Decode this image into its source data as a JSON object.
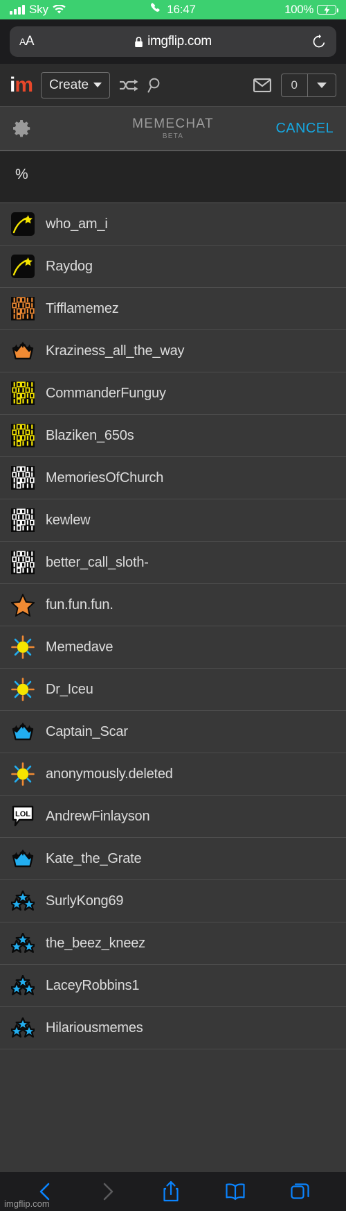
{
  "status_bar": {
    "carrier": "Sky",
    "signal_icon": "signal-bars-icon",
    "wifi_icon": "wifi-icon",
    "call_icon": "phone-call-icon",
    "time": "16:47",
    "battery_percent": "100%",
    "battery_icon": "battery-charging-icon"
  },
  "browser": {
    "text_size_small": "A",
    "text_size_big": "A",
    "lock_icon": "lock-icon",
    "url": "imgflip.com",
    "reload_icon": "reload-icon",
    "toolbar": {
      "back_icon": "chevron-left-icon",
      "forward_icon": "chevron-right-icon",
      "share_icon": "share-icon",
      "bookmarks_icon": "book-icon",
      "tabs_icon": "tabs-icon"
    }
  },
  "site_header": {
    "logo_i": "i",
    "logo_m": "m",
    "create_label": "Create",
    "create_caret_icon": "caret-down-icon",
    "shuffle_icon": "shuffle-icon",
    "search_icon": "search-icon",
    "mail_icon": "envelope-icon",
    "notification_count": "0",
    "notification_caret_icon": "caret-down-icon"
  },
  "memechat": {
    "gear_icon": "gear-icon",
    "title": "MEMECHAT",
    "subtitle": "BETA",
    "cancel_label": "CANCEL"
  },
  "search": {
    "value": "%",
    "placeholder": ""
  },
  "colors": {
    "status_bar_green": "#3cd070",
    "accent_blue": "#16a7e0",
    "link_blue": "#0a84ff",
    "logo_red": "#e8472a",
    "icon_yellow": "#f5e500",
    "icon_orange": "#f08a33",
    "icon_blue": "#22aef0",
    "list_bg": "#383838"
  },
  "users": [
    {
      "name": "who_am_i",
      "icon": "shooting-star-icon",
      "icon_color": "#f5e500"
    },
    {
      "name": "Raydog",
      "icon": "shooting-star-icon",
      "icon_color": "#f5e500"
    },
    {
      "name": "Tifflamemez",
      "icon": "binary-icon",
      "icon_color": "#f08a33"
    },
    {
      "name": "Kraziness_all_the_way",
      "icon": "crown-icon",
      "icon_color": "#f08a33"
    },
    {
      "name": "CommanderFunguy",
      "icon": "binary-icon",
      "icon_color": "#f5e500"
    },
    {
      "name": "Blaziken_650s",
      "icon": "binary-icon",
      "icon_color": "#f5e500"
    },
    {
      "name": "MemoriesOfChurch",
      "icon": "binary-icon",
      "icon_color": "#ffffff"
    },
    {
      "name": "kewlew",
      "icon": "binary-icon",
      "icon_color": "#ffffff"
    },
    {
      "name": "better_call_sloth-",
      "icon": "binary-icon",
      "icon_color": "#ffffff"
    },
    {
      "name": "fun.fun.fun.",
      "icon": "star-icon",
      "icon_color": "#f08a33"
    },
    {
      "name": "Memedave",
      "icon": "sun-icon",
      "icon_color": "#f5e500"
    },
    {
      "name": "Dr_Iceu",
      "icon": "sun-icon",
      "icon_color": "#f5e500"
    },
    {
      "name": "Captain_Scar",
      "icon": "crown-icon",
      "icon_color": "#22aef0"
    },
    {
      "name": "anonymously.deleted",
      "icon": "sun-icon",
      "icon_color": "#f5e500"
    },
    {
      "name": "AndrewFinlayson",
      "icon": "lol-bubble-icon",
      "icon_color": "#ffffff"
    },
    {
      "name": "Kate_the_Grate",
      "icon": "crown-icon",
      "icon_color": "#22aef0"
    },
    {
      "name": "SurlyKong69",
      "icon": "three-stars-icon",
      "icon_color": "#22aef0"
    },
    {
      "name": "the_beez_kneez",
      "icon": "three-stars-icon",
      "icon_color": "#22aef0"
    },
    {
      "name": "LaceyRobbins1",
      "icon": "three-stars-icon",
      "icon_color": "#22aef0"
    },
    {
      "name": "Hilariousmemes",
      "icon": "three-stars-icon",
      "icon_color": "#22aef0"
    }
  ],
  "watermark": "imgflip.com"
}
